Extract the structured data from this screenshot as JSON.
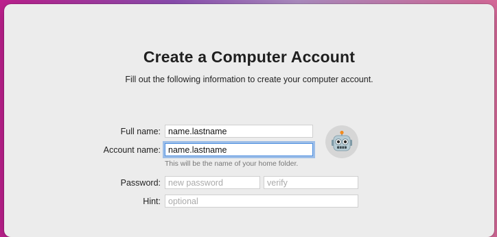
{
  "header": {
    "title": "Create a Computer Account",
    "subtitle": "Fill out the following information to create your computer account."
  },
  "form": {
    "full_name": {
      "label": "Full name:",
      "value": "name.lastname"
    },
    "account_name": {
      "label": "Account name:",
      "value": "name.lastname",
      "hint": "This will be the name of your home folder."
    },
    "password": {
      "label": "Password:",
      "placeholder": "new password",
      "verify_placeholder": "verify"
    },
    "hint": {
      "label": "Hint:",
      "placeholder": "optional"
    }
  },
  "avatar": {
    "icon": "robot-avatar-icon"
  },
  "colors": {
    "focus_ring": "#5c99e6",
    "window_bg": "#ececec"
  }
}
